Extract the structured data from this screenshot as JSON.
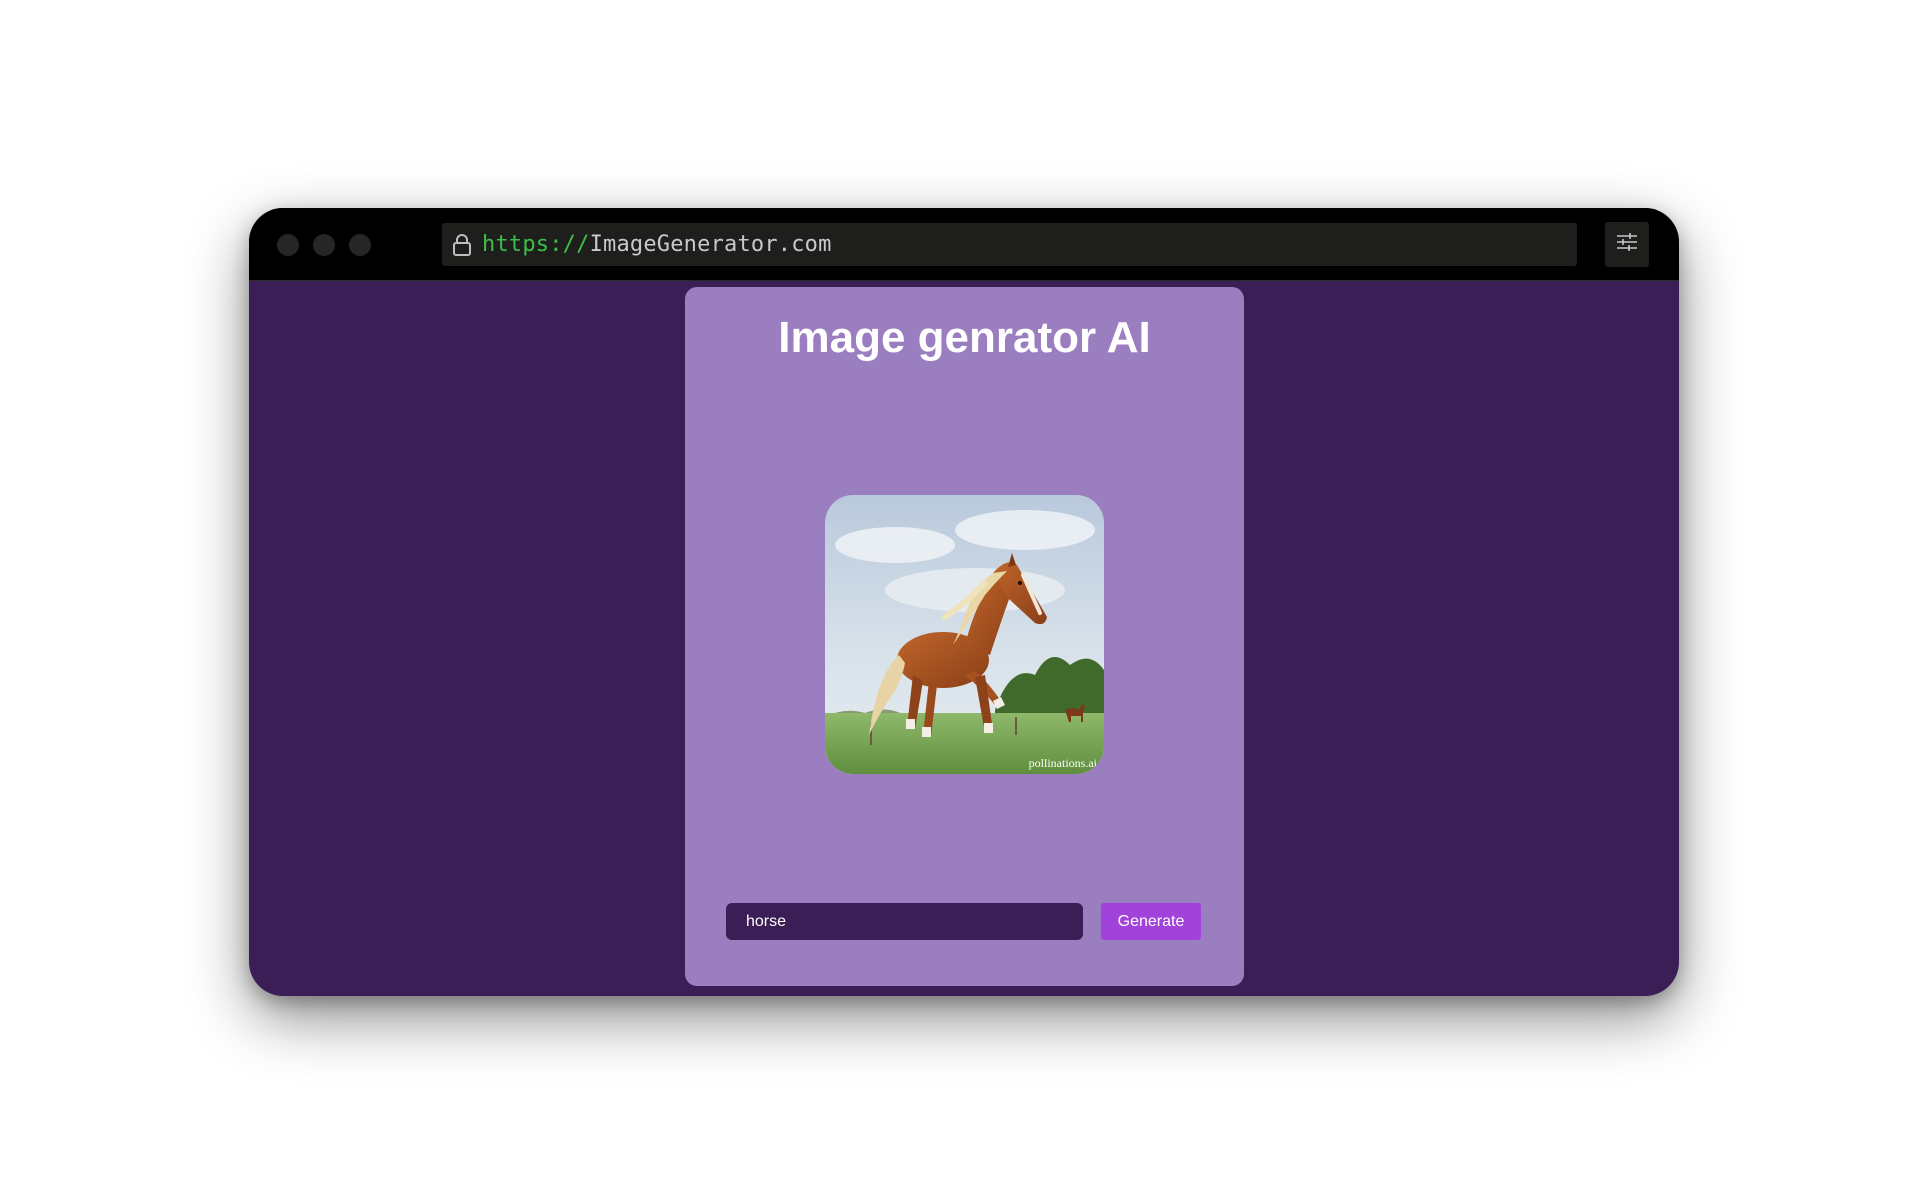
{
  "browser": {
    "url_scheme": "https://",
    "url_host": "ImageGenerator.com"
  },
  "app": {
    "title": "Image genrator AI",
    "image": {
      "alt": "horse",
      "watermark": "pollinations.ai"
    },
    "prompt": {
      "value": "horse",
      "placeholder": ""
    },
    "generate_label": "Generate"
  },
  "colors": {
    "page_background": "#3c1e57",
    "card_background": "#9b7ec0",
    "button": "#a142db",
    "url_scheme": "#3bbf4a"
  },
  "icons": {
    "lock": "lock-icon",
    "settings": "sliders-icon"
  }
}
